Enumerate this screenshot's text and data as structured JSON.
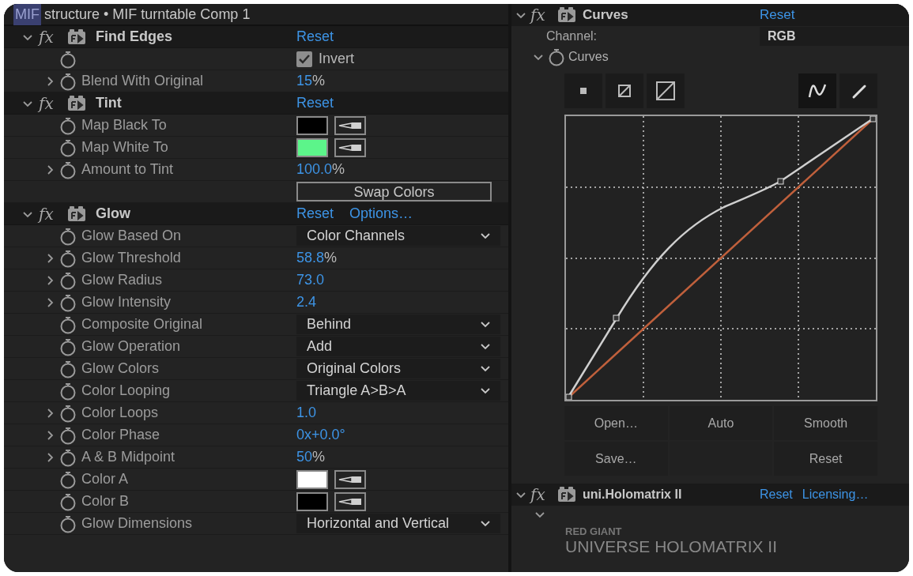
{
  "panel_title": {
    "selected_text": "MIF",
    "text": "structure • MIF turntable Comp 1"
  },
  "effects": [
    {
      "fx_label": "fx",
      "name": "Find Edges",
      "expanded": true,
      "actions": [
        "Reset"
      ],
      "properties": [
        {
          "stopwatch": true,
          "control": {
            "kind": "checkbox",
            "label": "Invert",
            "checked": true
          }
        },
        {
          "label": "Blend With Original",
          "stopwatch": true,
          "expanded": false,
          "control": {
            "kind": "number",
            "value": "15",
            "unit": "%"
          }
        }
      ]
    },
    {
      "fx_label": "fx",
      "name": "Tint",
      "expanded": true,
      "actions": [
        "Reset"
      ],
      "properties": [
        {
          "label": "Map Black To",
          "stopwatch": true,
          "control": {
            "kind": "color",
            "color": "#000000"
          }
        },
        {
          "label": "Map White To",
          "stopwatch": true,
          "control": {
            "kind": "color",
            "color": "#5cf58a"
          }
        },
        {
          "label": "Amount to Tint",
          "stopwatch": true,
          "expanded": false,
          "control": {
            "kind": "number",
            "value": "100.0",
            "unit": "%"
          }
        },
        {
          "stopwatch": false,
          "control": {
            "kind": "button",
            "label": "Swap Colors"
          }
        }
      ]
    },
    {
      "fx_label": "fx",
      "name": "Glow",
      "expanded": true,
      "actions": [
        "Reset",
        "Options…"
      ],
      "properties": [
        {
          "label": "Glow Based On",
          "stopwatch": true,
          "control": {
            "kind": "dropdown",
            "value": "Color Channels"
          }
        },
        {
          "label": "Glow Threshold",
          "stopwatch": true,
          "expanded": false,
          "control": {
            "kind": "number",
            "value": "58.8",
            "unit": "%"
          }
        },
        {
          "label": "Glow Radius",
          "stopwatch": true,
          "expanded": false,
          "control": {
            "kind": "number",
            "value": "73.0"
          }
        },
        {
          "label": "Glow Intensity",
          "stopwatch": true,
          "expanded": false,
          "control": {
            "kind": "number",
            "value": "2.4"
          }
        },
        {
          "label": "Composite Original",
          "stopwatch": true,
          "control": {
            "kind": "dropdown",
            "value": "Behind"
          }
        },
        {
          "label": "Glow Operation",
          "stopwatch": true,
          "control": {
            "kind": "dropdown",
            "value": "Add"
          }
        },
        {
          "label": "Glow Colors",
          "stopwatch": true,
          "control": {
            "kind": "dropdown",
            "value": "Original Colors"
          }
        },
        {
          "label": "Color Looping",
          "stopwatch": true,
          "control": {
            "kind": "dropdown",
            "value": "Triangle A>B>A"
          }
        },
        {
          "label": "Color Loops",
          "stopwatch": true,
          "expanded": false,
          "control": {
            "kind": "number",
            "value": "1.0"
          }
        },
        {
          "label": "Color Phase",
          "stopwatch": true,
          "expanded": false,
          "control": {
            "kind": "number",
            "value": "0x+0.0°"
          }
        },
        {
          "label": "A & B Midpoint",
          "stopwatch": true,
          "expanded": false,
          "control": {
            "kind": "number",
            "value": "50",
            "unit": "%"
          }
        },
        {
          "label": "Color A",
          "stopwatch": true,
          "control": {
            "kind": "color",
            "color": "#ffffff"
          }
        },
        {
          "label": "Color B",
          "stopwatch": true,
          "control": {
            "kind": "color",
            "color": "#000000"
          }
        },
        {
          "label": "Glow Dimensions",
          "stopwatch": true,
          "control": {
            "kind": "dropdown",
            "value": "Horizontal and Vertical"
          }
        }
      ]
    }
  ],
  "curves": {
    "fx_label": "fx",
    "name": "Curves",
    "expanded": true,
    "actions": [
      "Reset"
    ],
    "channel": {
      "label": "Channel:",
      "value": "RGB"
    },
    "curves_property": {
      "label": "Curves",
      "expanded": true
    },
    "tools": [
      {
        "kind": "size-small",
        "selected": false
      },
      {
        "kind": "size-medium",
        "selected": false
      },
      {
        "kind": "size-large",
        "selected": false
      },
      {
        "kind": "bezier",
        "selected": true
      },
      {
        "kind": "pencil",
        "selected": false
      }
    ],
    "button_rows": [
      {
        "left": "Open…",
        "middle": "Auto",
        "right": "Smooth"
      },
      {
        "left": "Save…",
        "right": "Reset"
      }
    ]
  },
  "holomatrix": {
    "fx_label": "fx",
    "name": "uni.Holomatrix II",
    "expanded": true,
    "actions": [
      "Reset",
      "Licensing…"
    ],
    "sub_expanded": true,
    "brand": "RED GIANT",
    "product": "UNIVERSE HOLOMATRIX II"
  }
}
